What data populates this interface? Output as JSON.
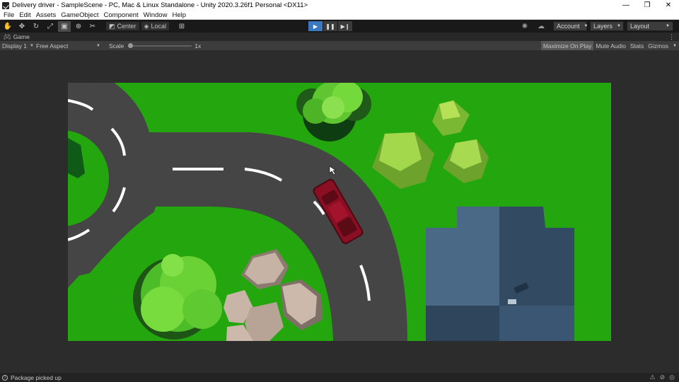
{
  "window": {
    "title": "Delivery driver - SampleScene - PC, Mac & Linux Standalone - Unity 2020.3.26f1 Personal <DX11>",
    "controls": [
      "—",
      "❐",
      "✕"
    ]
  },
  "menu": [
    "File",
    "Edit",
    "Assets",
    "GameObject",
    "Component",
    "Window",
    "Help"
  ],
  "toolbar": {
    "tools": [
      "hand-tool-icon",
      "move-tool-icon",
      "rotate-tool-icon",
      "scale-tool-icon",
      "rect-tool-icon",
      "transform-tool-icon",
      "custom-tool-icon"
    ],
    "pivot_label": "Center",
    "space_label": "Local",
    "account_label": "Account",
    "layers_label": "Layers",
    "layout_label": "Layout"
  },
  "game_tab": {
    "label": "Game"
  },
  "game_toolbar": {
    "display": "Display 1",
    "aspect": "Free Aspect",
    "scale_label": "Scale",
    "scale_value": "1x",
    "maximize": "Maximize On Play",
    "mute": "Mute Audio",
    "stats": "Stats",
    "gizmos": "Gizmos"
  },
  "status": {
    "message": "Package picked up"
  },
  "colors": {
    "grass": "#24a70e",
    "road": "#454546",
    "car": "#8a0f22",
    "house_roof": "#3f5b78",
    "bush": "#6fd438",
    "tree": "#9ed649",
    "rock": "#c8b4a6",
    "play_active": "#3a79c2"
  }
}
